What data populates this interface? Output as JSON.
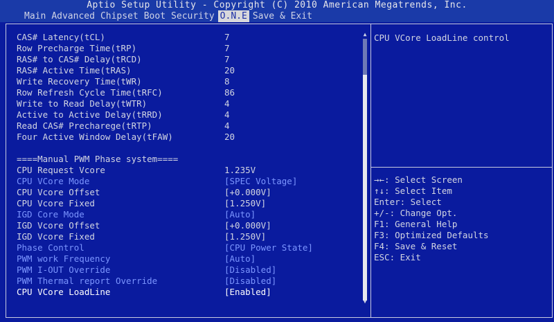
{
  "header": {
    "title": "Aptio Setup Utility - Copyright (C) 2010 American Megatrends, Inc.",
    "tabs": [
      "Main",
      "Advanced",
      "Chipset",
      "Boot",
      "Security",
      "O.N.E",
      "Save & Exit"
    ],
    "active_tab": "O.N.E"
  },
  "settings": [
    {
      "label": "CAS# Latency(tCL)",
      "value": "7"
    },
    {
      "label": "Row Precharge Time(tRP)",
      "value": "7"
    },
    {
      "label": "RAS# to CAS# Delay(tRCD)",
      "value": "7"
    },
    {
      "label": "RAS# Active Time(tRAS)",
      "value": "20"
    },
    {
      "label": "Write Recovery Time(tWR)",
      "value": "8"
    },
    {
      "label": "Row Refresh Cycle Time(tRFC)",
      "value": "86"
    },
    {
      "label": "Write to Read Delay(tWTR)",
      "value": "4"
    },
    {
      "label": "Active to Active Delay(tRRD)",
      "value": "4"
    },
    {
      "label": "Read CAS# Precharege(tRTP)",
      "value": "4"
    },
    {
      "label": "Four Active Window Delay(tFAW)",
      "value": "20"
    },
    {
      "label": "",
      "value": ""
    },
    {
      "label": "====Manual PWM Phase system====",
      "value": ""
    },
    {
      "label": "CPU Request Vcore",
      "value": "1.235V"
    },
    {
      "label": "CPU VCore Mode",
      "value": "[SPEC Voltage]",
      "editable": true
    },
    {
      "label": "CPU Vcore Offset",
      "value": "[+0.000V]"
    },
    {
      "label": "CPU Vcore Fixed",
      "value": "[1.250V]"
    },
    {
      "label": "IGD Core Mode",
      "value": "[Auto]",
      "editable": true
    },
    {
      "label": "IGD Vcore Offset",
      "value": "[+0.000V]"
    },
    {
      "label": "IGD Vcore Fixed",
      "value": "[1.250V]"
    },
    {
      "label": "Phase Control",
      "value": "[CPU Power State]",
      "editable": true
    },
    {
      "label": "PWM work Frequency",
      "value": "[Auto]",
      "editable": true
    },
    {
      "label": "PWM I-OUT Override",
      "value": "[Disabled]",
      "editable": true
    },
    {
      "label": "PWM Thermal report Override",
      "value": "[Disabled]",
      "editable": true
    },
    {
      "label": "CPU VCore LoadLine",
      "value": "[Enabled]",
      "selected": true
    }
  ],
  "help_text": "CPU VCore LoadLine control",
  "key_help": [
    "→←: Select Screen",
    "↑↓: Select Item",
    "Enter: Select",
    "+/-: Change Opt.",
    "F1: General Help",
    "F3: Optimized Defaults",
    "F4: Save & Reset",
    "ESC: Exit"
  ],
  "scroll": {
    "up_icon": "▲",
    "down_icon": "▼"
  },
  "colors": {
    "background": "#0a1b9e",
    "header": "#1a3aa8",
    "editable_text": "#7b95ff",
    "text": "#d2d5e2",
    "active_tab_bg": "#d8d8dc"
  }
}
